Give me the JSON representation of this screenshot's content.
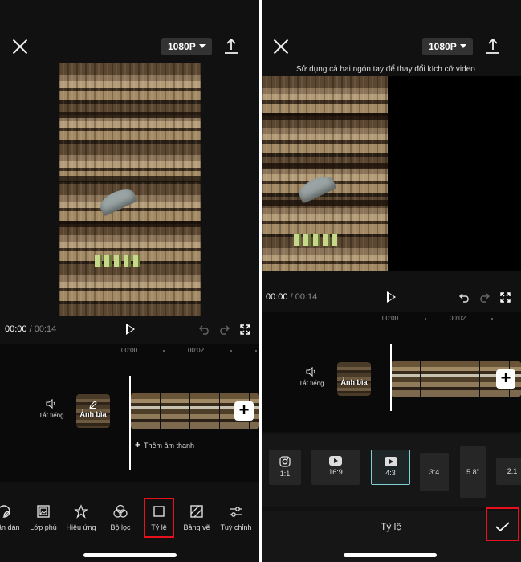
{
  "left": {
    "resolution": "1080P",
    "time_current": "00:00",
    "time_separator": "/",
    "time_total": "00:14",
    "ticks": [
      "00:00",
      "00:02"
    ],
    "mute_label": "Tắt tiếng",
    "cover_label": "Ảnh bìa",
    "add_audio": "Thêm âm thanh",
    "add_audio_icon": "+",
    "add_clip_icon": "+",
    "tools": [
      "Nhãn dán",
      "Lớp phủ",
      "Hiệu ứng",
      "Bộ lọc",
      "Tỷ lệ",
      "Bảng vẽ",
      "Tuỳ chỉnh"
    ],
    "highlight_color": "#e8101c"
  },
  "right": {
    "resolution": "1080P",
    "hint": "Sử dụng cả hai ngón tay để thay đổi kích cỡ video",
    "time_current": "00:00",
    "time_separator": "/",
    "time_total": "00:14",
    "ticks": [
      "00:00",
      "00:02"
    ],
    "mute_label": "Tắt tiếng",
    "cover_label": "Ảnh bìa",
    "add_clip_icon": "+",
    "ratios": [
      "1:1",
      "16:9",
      "4:3",
      "3:4",
      "5.8\"",
      "2:1"
    ],
    "ratio_icons": [
      "instagram-icon",
      "youtube-icon",
      "youtube-icon"
    ],
    "selected_ratio": "4:3",
    "selected_color": "#7fd1d6",
    "panel_title": "Tỷ lệ",
    "highlight_color": "#e8101c"
  }
}
